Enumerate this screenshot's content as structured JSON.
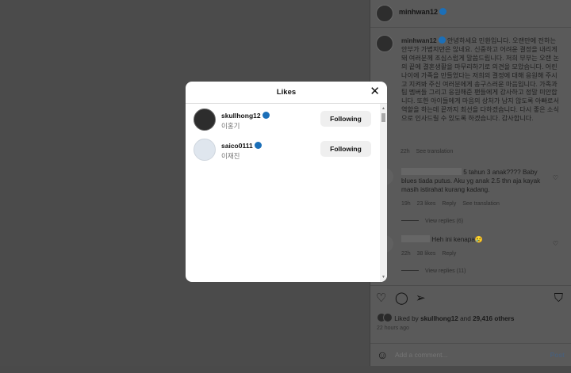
{
  "modal": {
    "title": "Likes",
    "close_glyph": "✕",
    "users": [
      {
        "username": "skullhong12",
        "name": "이홍기",
        "button": "Following"
      },
      {
        "username": "saico0111",
        "name": "이재진",
        "button": "Following"
      }
    ]
  },
  "post": {
    "author": "minhwan12",
    "caption": "안녕하세요 민환입니다. 오랜만에 전하는 안부가 가볍지만은 않네요. 신중하고 어려운 결정을 내리게 돼 여러분께 조심스럽게 말씀드립니다. 저희 부부는 오랜 논의 끝에 결혼생활을 마무리하기로 의견을 모았습니다. 어린 나이에 가족을 만들었다는 저희의 결정에 대해 응원해 주시고 지켜봐 주신 여러분에게 송구스러운 마음입니다. 가족과 팀 멤버들 그리고 응원해준 팬들에게 감사하고 정말 미안합니다. 또한 아이들에게 마음의 상처가 남지 않도록 아빠로서 역할을 하는데 끝까지 최선을 다하겠습니다. 다시 좋은 소식으로 인사드릴 수 있도록 하겠습니다. 감사합니다.",
    "caption_time": "22h",
    "see_translation": "See translation",
    "comments": [
      {
        "text": "5 tahun 3 anak???? Baby blues tiada putus. Aku yg anak 2.5 thn aja kayak masih istirahat kurang kadang.",
        "time": "19h",
        "likes": "23 likes",
        "reply": "Reply",
        "translation": "See translation",
        "view_replies": "View replies (6)"
      },
      {
        "text": "Heh ini kenapa😢",
        "time": "22h",
        "likes": "38 likes",
        "reply": "Reply",
        "view_replies": "View replies (11)"
      }
    ],
    "liked_by_prefix": "Liked by ",
    "liked_by_user": "skullhong12",
    "liked_by_and": " and ",
    "liked_by_others": "29,416 others",
    "post_time": "22 hours ago",
    "comment_placeholder": "Add a comment...",
    "post_button": "Post"
  },
  "icons": {
    "heart": "♡",
    "comment": "◯",
    "share": "➢",
    "save": "⛉",
    "emoji": "☺"
  },
  "colors": {
    "verified": "#1b6fb8",
    "overlay": "#4b4b4b",
    "modal_bg": "#ffffff"
  }
}
